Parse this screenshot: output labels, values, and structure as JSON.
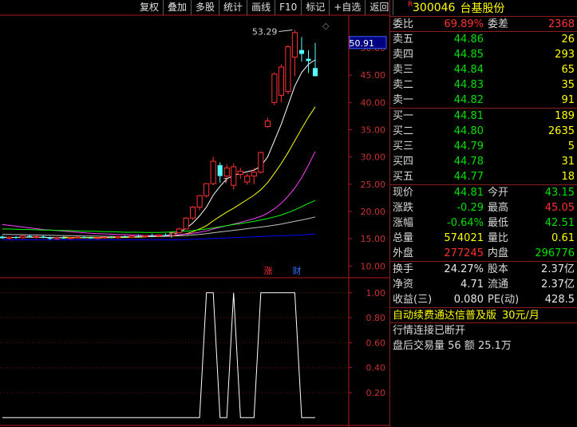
{
  "toolbar": {
    "buttons": [
      "复权",
      "叠加",
      "多股",
      "统计",
      "画线",
      "F10",
      "标记",
      "+自选",
      "返回"
    ]
  },
  "chart_data": {
    "type": "candlestick",
    "y_ticks": [
      "50.00",
      "45.00",
      "40.00",
      "35.00",
      "30.00",
      "25.00",
      "20.00",
      "15.00",
      "10.00"
    ],
    "ylim": [
      8,
      56
    ],
    "price_label": "50.91",
    "high_annotation": "53.29",
    "event_marks": [
      "涨",
      "财"
    ],
    "candles": [
      {
        "o": 15.4,
        "h": 15.6,
        "l": 15.0,
        "c": 15.1
      },
      {
        "o": 15.1,
        "h": 15.4,
        "l": 14.9,
        "c": 15.3
      },
      {
        "o": 15.3,
        "h": 15.5,
        "l": 15.0,
        "c": 15.2
      },
      {
        "o": 15.2,
        "h": 15.6,
        "l": 15.0,
        "c": 15.5
      },
      {
        "o": 15.5,
        "h": 15.8,
        "l": 15.2,
        "c": 15.3
      },
      {
        "o": 15.3,
        "h": 15.6,
        "l": 15.0,
        "c": 15.4
      },
      {
        "o": 15.4,
        "h": 15.7,
        "l": 15.1,
        "c": 15.2
      },
      {
        "o": 15.2,
        "h": 15.4,
        "l": 14.8,
        "c": 15.0
      },
      {
        "o": 15.0,
        "h": 15.3,
        "l": 14.8,
        "c": 15.2
      },
      {
        "o": 15.2,
        "h": 15.5,
        "l": 15.0,
        "c": 15.1
      },
      {
        "o": 15.1,
        "h": 15.3,
        "l": 14.9,
        "c": 15.2
      },
      {
        "o": 15.2,
        "h": 15.4,
        "l": 15.0,
        "c": 15.3
      },
      {
        "o": 15.3,
        "h": 15.6,
        "l": 15.1,
        "c": 15.2
      },
      {
        "o": 15.2,
        "h": 15.4,
        "l": 15.0,
        "c": 15.1
      },
      {
        "o": 15.1,
        "h": 15.3,
        "l": 14.9,
        "c": 15.2
      },
      {
        "o": 15.2,
        "h": 15.4,
        "l": 15.0,
        "c": 15.3
      },
      {
        "o": 15.3,
        "h": 15.5,
        "l": 15.1,
        "c": 15.2
      },
      {
        "o": 15.2,
        "h": 15.5,
        "l": 15.0,
        "c": 15.4
      },
      {
        "o": 15.4,
        "h": 15.6,
        "l": 15.2,
        "c": 15.3
      },
      {
        "o": 15.3,
        "h": 15.5,
        "l": 15.1,
        "c": 15.5
      },
      {
        "o": 15.5,
        "h": 15.8,
        "l": 15.2,
        "c": 15.4
      },
      {
        "o": 15.4,
        "h": 15.6,
        "l": 15.2,
        "c": 15.6
      },
      {
        "o": 15.6,
        "h": 15.9,
        "l": 15.4,
        "c": 15.5
      },
      {
        "o": 15.5,
        "h": 15.8,
        "l": 15.3,
        "c": 15.7
      },
      {
        "o": 15.7,
        "h": 16.0,
        "l": 15.5,
        "c": 15.6
      },
      {
        "o": 15.6,
        "h": 16.2,
        "l": 15.5,
        "c": 16.1
      },
      {
        "o": 16.1,
        "h": 17.0,
        "l": 16.0,
        "c": 16.8
      },
      {
        "o": 16.8,
        "h": 19.0,
        "l": 16.7,
        "c": 18.8
      },
      {
        "o": 18.8,
        "h": 21.0,
        "l": 18.5,
        "c": 20.8
      },
      {
        "o": 20.8,
        "h": 23.0,
        "l": 20.2,
        "c": 22.9
      },
      {
        "o": 22.9,
        "h": 25.2,
        "l": 22.5,
        "c": 25.1
      },
      {
        "o": 25.1,
        "h": 30.0,
        "l": 24.8,
        "c": 29.2
      },
      {
        "o": 28.5,
        "h": 29.0,
        "l": 25.3,
        "c": 26.5
      },
      {
        "o": 26.5,
        "h": 28.6,
        "l": 25.5,
        "c": 28.0
      },
      {
        "o": 24.8,
        "h": 28.8,
        "l": 24.0,
        "c": 28.2
      },
      {
        "o": 26.8,
        "h": 28.0,
        "l": 26.0,
        "c": 27.4
      },
      {
        "o": 25.4,
        "h": 27.0,
        "l": 24.9,
        "c": 26.5
      },
      {
        "o": 26.5,
        "h": 28.0,
        "l": 25.0,
        "c": 27.2
      },
      {
        "o": 27.2,
        "h": 31.0,
        "l": 27.0,
        "c": 30.8
      },
      {
        "o": 35.6,
        "h": 37.2,
        "l": 35.3,
        "c": 36.6
      },
      {
        "o": 40.0,
        "h": 45.5,
        "l": 39.5,
        "c": 45.2
      },
      {
        "o": 41.3,
        "h": 47.0,
        "l": 40.0,
        "c": 46.5
      },
      {
        "o": 42.0,
        "h": 50.5,
        "l": 41.5,
        "c": 50.2
      },
      {
        "o": 48.3,
        "h": 53.29,
        "l": 44.8,
        "c": 52.8
      },
      {
        "o": 49.6,
        "h": 52.0,
        "l": 47.5,
        "c": 48.9
      },
      {
        "o": 48.0,
        "h": 49.6,
        "l": 45.4,
        "c": 47.6
      },
      {
        "o": 46.3,
        "h": 50.91,
        "l": 44.8,
        "c": 44.81
      }
    ],
    "ma_lines": [
      {
        "color": "#ffffff",
        "values": [
          15.3,
          15.25,
          15.25,
          15.3,
          15.3,
          15.3,
          15.25,
          15.2,
          15.2,
          15.2,
          15.2,
          15.2,
          15.2,
          15.2,
          15.2,
          15.25,
          15.25,
          15.3,
          15.3,
          15.35,
          15.4,
          15.45,
          15.5,
          15.55,
          15.6,
          15.8,
          16.2,
          16.9,
          17.9,
          19.2,
          20.8,
          23.0,
          24.6,
          26.0,
          26.6,
          27.0,
          27.3,
          27.6,
          28.3,
          30.0,
          33.0,
          36.0,
          39.5,
          43.0,
          45.5,
          47.0,
          47.8
        ]
      },
      {
        "color": "#ffff00",
        "values": [
          null,
          null,
          null,
          null,
          null,
          null,
          null,
          null,
          null,
          15.3,
          15.25,
          15.2,
          15.2,
          15.2,
          15.2,
          15.2,
          15.2,
          15.25,
          15.25,
          15.3,
          15.3,
          15.35,
          15.4,
          15.45,
          15.5,
          15.55,
          15.7,
          15.9,
          16.3,
          16.8,
          17.4,
          18.3,
          19.1,
          19.9,
          20.6,
          21.4,
          22.2,
          23.0,
          24.0,
          25.3,
          27.0,
          28.8,
          30.8,
          33.0,
          35.2,
          37.3,
          39.2
        ]
      },
      {
        "color": "#ff40ff",
        "values": [
          17.6,
          17.45,
          17.3,
          17.15,
          17.0,
          16.85,
          16.7,
          16.6,
          16.5,
          16.4,
          16.3,
          16.2,
          16.1,
          16.0,
          15.95,
          15.9,
          15.85,
          15.8,
          15.75,
          15.7,
          15.65,
          15.6,
          15.6,
          15.6,
          15.6,
          15.65,
          15.75,
          15.85,
          16.0,
          16.2,
          16.45,
          16.8,
          17.1,
          17.4,
          17.7,
          18.0,
          18.35,
          18.7,
          19.1,
          19.7,
          20.5,
          21.5,
          22.8,
          24.3,
          26.2,
          28.5,
          31.0
        ]
      },
      {
        "color": "#00ff00",
        "values": [
          16.8,
          16.8,
          16.75,
          16.7,
          16.7,
          16.65,
          16.6,
          16.6,
          16.55,
          16.5,
          16.5,
          16.45,
          16.4,
          16.4,
          16.35,
          16.3,
          16.3,
          16.25,
          16.2,
          16.2,
          16.2,
          16.15,
          16.15,
          16.15,
          16.2,
          16.25,
          16.3,
          16.4,
          16.5,
          16.65,
          16.8,
          17.0,
          17.2,
          17.4,
          17.6,
          17.8,
          18.0,
          18.2,
          18.45,
          18.7,
          19.0,
          19.35,
          19.8,
          20.3,
          20.9,
          21.5,
          22.0
        ]
      },
      {
        "color": "#c0c0c0",
        "values": [
          15.8,
          15.8,
          15.75,
          15.75,
          15.7,
          15.7,
          15.65,
          15.65,
          15.6,
          15.6,
          15.55,
          15.55,
          15.5,
          15.5,
          15.5,
          15.45,
          15.45,
          15.4,
          15.4,
          15.4,
          15.4,
          15.4,
          15.4,
          15.4,
          15.45,
          15.5,
          15.55,
          15.6,
          15.7,
          15.8,
          15.95,
          16.1,
          16.25,
          16.4,
          16.55,
          16.7,
          16.85,
          17.0,
          17.15,
          17.3,
          17.5,
          17.7,
          17.95,
          18.2,
          18.45,
          18.7,
          19.0
        ]
      },
      {
        "color": "#0000ff",
        "values": [
          14.8,
          14.8,
          14.8,
          14.8,
          14.8,
          14.8,
          14.8,
          14.8,
          14.8,
          14.8,
          14.8,
          14.8,
          14.8,
          14.8,
          14.8,
          14.8,
          14.8,
          14.8,
          14.8,
          14.8,
          14.8,
          14.8,
          14.8,
          14.8,
          14.8,
          14.8,
          14.8,
          14.85,
          14.9,
          14.95,
          15.0,
          15.05,
          15.1,
          15.15,
          15.2,
          15.25,
          15.3,
          15.35,
          15.4,
          15.45,
          15.5,
          15.55,
          15.6,
          15.65,
          15.7,
          15.8,
          15.9
        ]
      }
    ],
    "indicator": {
      "y_ticks": [
        "1.00",
        "0.80",
        "0.60",
        "0.40",
        "0.20"
      ],
      "ylim": [
        -0.05,
        1.12
      ],
      "values": [
        0,
        0,
        0,
        0,
        0,
        0,
        0,
        0,
        0,
        0,
        0,
        0,
        0,
        0,
        0,
        0,
        0,
        0,
        0,
        0,
        0,
        0,
        0,
        0,
        0,
        0,
        0,
        0,
        0,
        0,
        1,
        1,
        0,
        0,
        1,
        0,
        0,
        0,
        1,
        1,
        1,
        1,
        1,
        1,
        0,
        0,
        0
      ]
    }
  },
  "stock": {
    "r_mark": "R",
    "code": "300046",
    "name": "台基股份"
  },
  "committee": {
    "ratio_label": "委比",
    "ratio_value": "69.89%",
    "diff_label": "委差",
    "diff_value": "2368"
  },
  "asks": [
    {
      "label": "卖五",
      "price": "44.86",
      "volume": "26"
    },
    {
      "label": "卖四",
      "price": "44.85",
      "volume": "293"
    },
    {
      "label": "卖三",
      "price": "44.84",
      "volume": "65"
    },
    {
      "label": "卖二",
      "price": "44.83",
      "volume": "35"
    },
    {
      "label": "卖一",
      "price": "44.82",
      "volume": "91"
    }
  ],
  "bids": [
    {
      "label": "买一",
      "price": "44.81",
      "volume": "189"
    },
    {
      "label": "买二",
      "price": "44.80",
      "volume": "2635"
    },
    {
      "label": "买三",
      "price": "44.79",
      "volume": "5"
    },
    {
      "label": "买四",
      "price": "44.78",
      "volume": "31"
    },
    {
      "label": "买五",
      "price": "44.77",
      "volume": "18"
    }
  ],
  "quote": {
    "now_label": "现价",
    "now_value": "44.81",
    "open_label": "今开",
    "open_value": "43.15",
    "chg_label": "涨跌",
    "chg_value": "-0.29",
    "high_label": "最高",
    "high_value": "45.05",
    "pct_label": "涨幅",
    "pct_value": "-0.64%",
    "low_label": "最低",
    "low_value": "42.51",
    "vol_label": "总量",
    "vol_value": "574021",
    "vr_label": "量比",
    "vr_value": "0.61",
    "out_label": "外盘",
    "out_value": "277245",
    "in_label": "内盘",
    "in_value": "296776"
  },
  "fund": {
    "turn_label": "换手",
    "turn_value": "24.27%",
    "cap_label": "股本",
    "cap_value": "2.37亿",
    "nav_label": "净资",
    "nav_value": "4.71",
    "float_label": "流通",
    "float_value": "2.37亿",
    "eps_label": "收益(三)",
    "eps_value": "0.080",
    "pe_label": "PE(动)",
    "pe_value": "428.5"
  },
  "promo": {
    "text": "自动续费通达信普及版",
    "price": "30元/月"
  },
  "status": {
    "connection": "行情连接已断开",
    "after_hours": "盘后交易量 56 额 25.1万"
  }
}
